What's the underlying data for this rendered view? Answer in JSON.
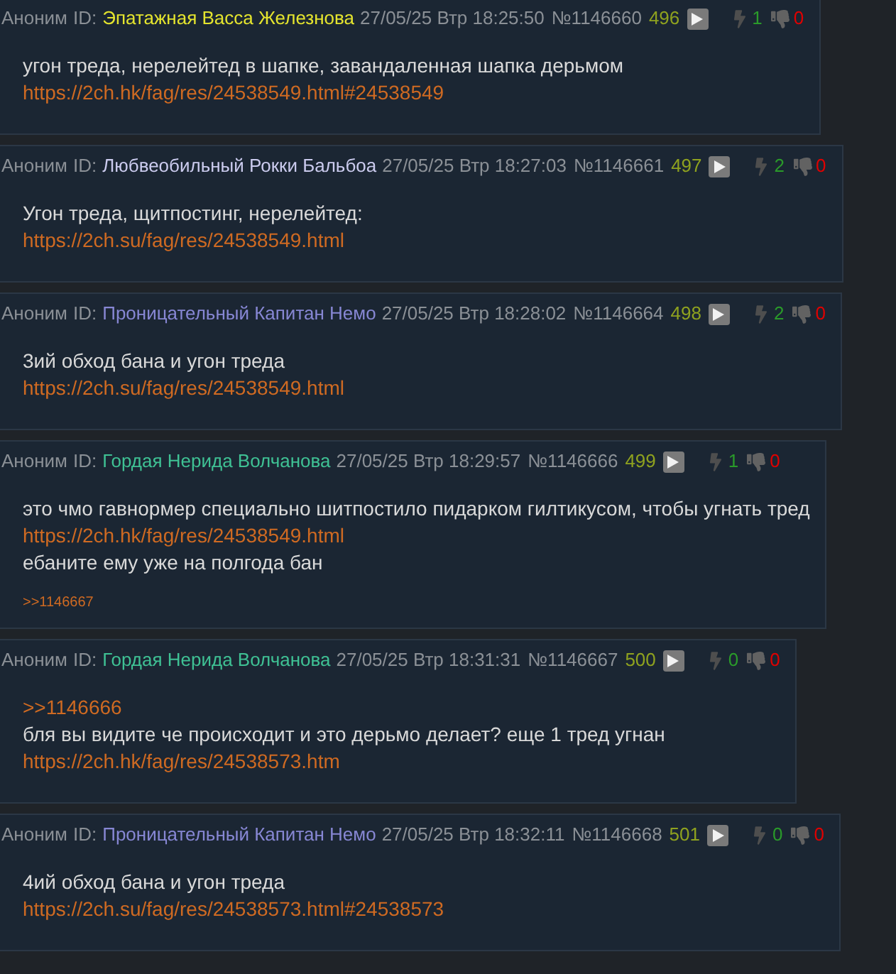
{
  "posts": [
    {
      "author": "Аноним",
      "id_label": "ID:",
      "poster": {
        "name": "Эпатажная Васса Железнова",
        "color": "#e4e42e"
      },
      "date": "27/05/25 Втр 18:25:50",
      "number": "№1146660",
      "count": "496",
      "likes": "1",
      "dislikes": "0",
      "body": [
        {
          "kind": "text",
          "text": "угон треда, нерелейтед в шапке, завандаленная шапка дерьмом"
        },
        {
          "kind": "link",
          "text": "https://2ch.hk/fag/res/24538549.html#24538549"
        }
      ]
    },
    {
      "author": "Аноним",
      "id_label": "ID:",
      "poster": {
        "name": "Любвеобильный Рокки Бальбоа",
        "color": "#cbcbee"
      },
      "date": "27/05/25 Втр 18:27:03",
      "number": "№1146661",
      "count": "497",
      "likes": "2",
      "dislikes": "0",
      "body": [
        {
          "kind": "text",
          "text": "Угон треда, щитпостинг, нерелейтед:"
        },
        {
          "kind": "link",
          "text": "https://2ch.su/fag/res/24538549.html"
        }
      ]
    },
    {
      "author": "Аноним",
      "id_label": "ID:",
      "poster": {
        "name": "Проницательный Капитан Немо",
        "color": "#8787d4"
      },
      "date": "27/05/25 Втр 18:28:02",
      "number": "№1146664",
      "count": "498",
      "likes": "2",
      "dislikes": "0",
      "body": [
        {
          "kind": "text",
          "text": "3ий обход бана и угон треда"
        },
        {
          "kind": "link",
          "text": "https://2ch.su/fag/res/24538549.html"
        }
      ]
    },
    {
      "author": "Аноним",
      "id_label": "ID:",
      "poster": {
        "name": "Гордая Нерида Волчанова",
        "color": "#3fc194"
      },
      "date": "27/05/25 Втр 18:29:57",
      "number": "№1146666",
      "count": "499",
      "likes": "1",
      "dislikes": "0",
      "body": [
        {
          "kind": "text",
          "text": "это чмо гавнормер специально шитпостило пидарком гилтикусом, чтобы угнать тред"
        },
        {
          "kind": "link",
          "text": "https://2ch.hk/fag/res/24538549.html"
        },
        {
          "kind": "text",
          "text": "ебаните ему уже на полгода бан"
        }
      ],
      "replies": [
        ">>1146667"
      ]
    },
    {
      "author": "Аноним",
      "id_label": "ID:",
      "poster": {
        "name": "Гордая Нерида Волчанова",
        "color": "#3fc194"
      },
      "date": "27/05/25 Втр 18:31:31",
      "number": "№1146667",
      "count": "500",
      "likes": "0",
      "dislikes": "0",
      "body": [
        {
          "kind": "reply",
          "text": ">>1146666"
        },
        {
          "kind": "text",
          "text": "бля вы видите че происходит и это дерьмо делает? еще 1 тред угнан"
        },
        {
          "kind": "link",
          "text": "https://2ch.hk/fag/res/24538573.htm"
        }
      ]
    },
    {
      "author": "Аноним",
      "id_label": "ID:",
      "poster": {
        "name": "Проницательный Капитан Немо",
        "color": "#8787d4"
      },
      "date": "27/05/25 Втр 18:32:11",
      "number": "№1146668",
      "count": "501",
      "likes": "0",
      "dislikes": "0",
      "body": [
        {
          "kind": "text",
          "text": "4ий обход бана и угон треда"
        },
        {
          "kind": "link",
          "text": "https://2ch.su/fag/res/24538573.html#24538573"
        }
      ]
    }
  ]
}
